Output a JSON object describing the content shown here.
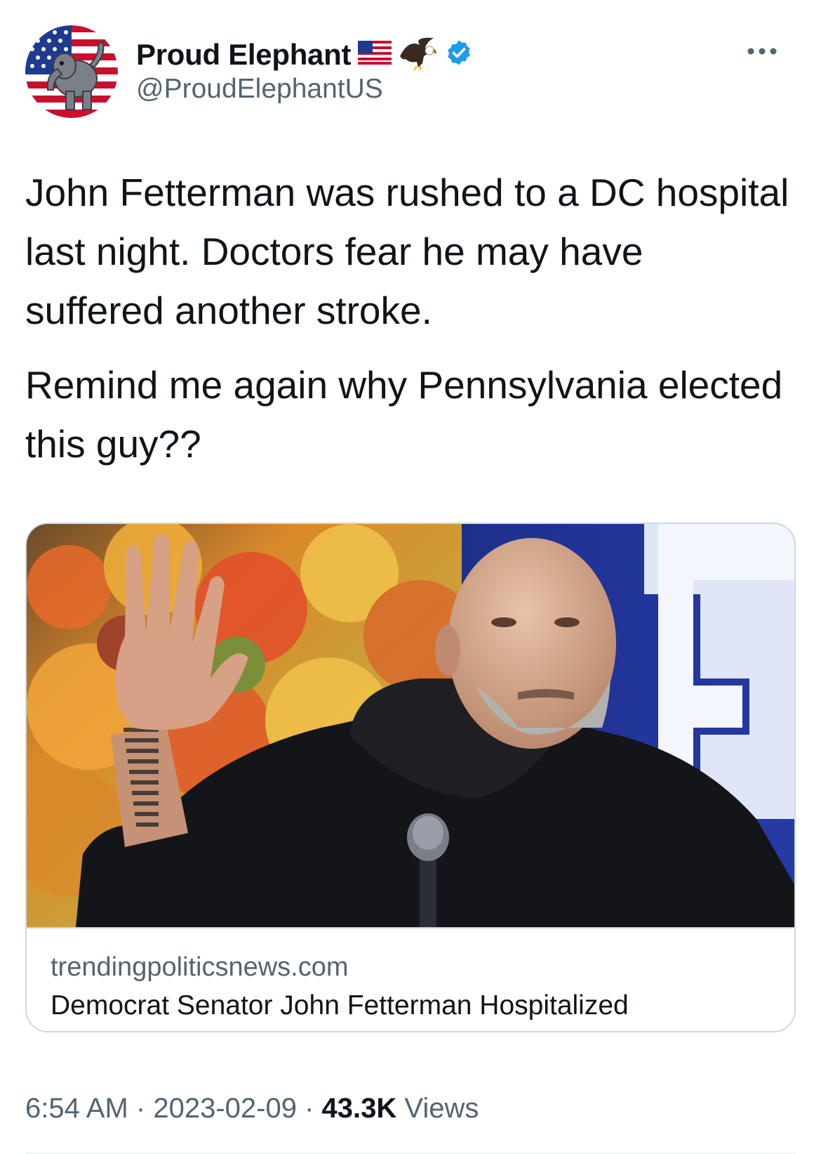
{
  "tweet": {
    "author": {
      "display_name": "Proud Elephant",
      "handle": "@ProudElephantUS",
      "badges": [
        "us-flag-icon",
        "eagle-icon",
        "verified-badge-icon"
      ]
    },
    "text_paragraphs": [
      "John Fetterman was rushed to a DC hospital last night. Doctors fear he may have suffered another stroke.",
      "Remind me again why Pennsylvania elected this guy??"
    ],
    "card": {
      "domain": "trendingpoliticsnews.com",
      "title": "Democrat Senator John Fetterman Hospitalized"
    },
    "time": "6:54 AM",
    "date": "2023-02-09",
    "views_count": "43.3K",
    "views_label": "Views",
    "separator": "·"
  },
  "colors": {
    "text_primary": "#0f1419",
    "text_secondary": "#536471",
    "verified_blue": "#1d9bf0",
    "border": "#cfd9de"
  }
}
